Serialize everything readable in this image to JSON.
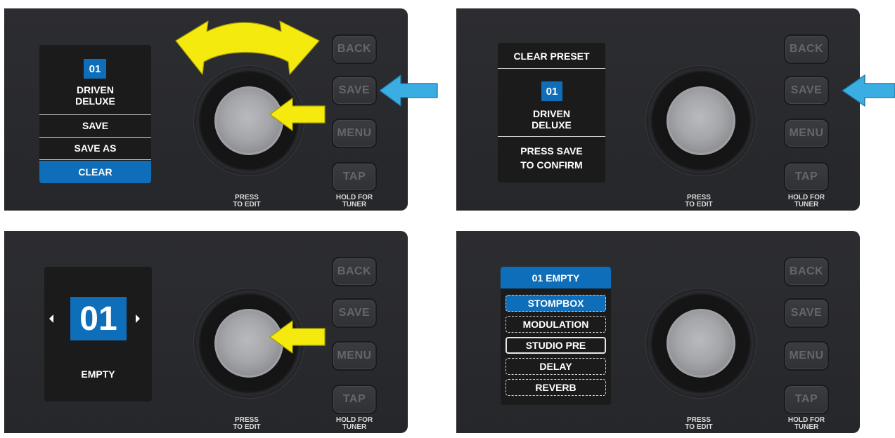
{
  "controls": {
    "back": "BACK",
    "save": "SAVE",
    "menu": "MENU",
    "tap": "TAP",
    "knob_caption_1": "PRESS",
    "knob_caption_2": "TO EDIT",
    "tap_caption_1": "HOLD FOR",
    "tap_caption_2": "TUNER"
  },
  "panel1": {
    "preset_number": "01",
    "preset_name_1": "DRIVEN",
    "preset_name_2": "DELUXE",
    "menu_items": [
      "SAVE",
      "SAVE AS",
      "CLEAR"
    ],
    "selected_item": "CLEAR"
  },
  "panel2": {
    "title": "CLEAR PRESET",
    "preset_number": "01",
    "preset_name_1": "DRIVEN",
    "preset_name_2": "DELUXE",
    "prompt_1": "PRESS SAVE",
    "prompt_2": "TO CONFIRM"
  },
  "panel3": {
    "preset_number": "01",
    "preset_name": "EMPTY"
  },
  "panel4": {
    "header": "01 EMPTY",
    "chain_items": [
      "STOMPBOX",
      "MODULATION",
      "STUDIO PRE",
      "DELAY",
      "REVERB"
    ],
    "selected_item": "STOMPBOX"
  },
  "colors": {
    "accent_blue": "#0f6eb9",
    "arrow_yellow": "#f5ea0e",
    "arrow_blue": "#3aaee3",
    "panel_bg": "#2a2b2f"
  }
}
